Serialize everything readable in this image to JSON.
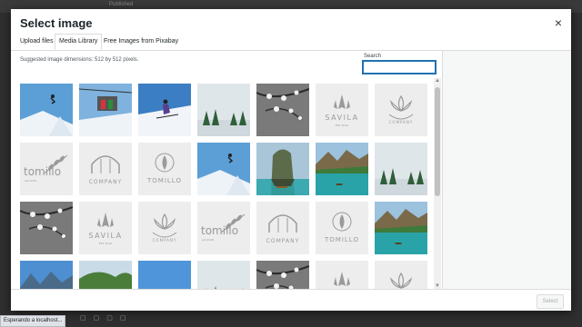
{
  "modal": {
    "title": "Select image",
    "close_glyph": "×",
    "tabs": [
      {
        "label": "Upload files",
        "active": false
      },
      {
        "label": "Media Library",
        "active": true
      },
      {
        "label": "Free Images from Pixabay",
        "active": false
      }
    ],
    "hint": "Suggested image dimensions: 512 by 512 pixels.",
    "search": {
      "label": "Search",
      "value": "",
      "placeholder": ""
    },
    "select_label": "Select"
  },
  "thumbnails": [
    {
      "kind": "snow-jump"
    },
    {
      "kind": "chairlift"
    },
    {
      "kind": "ski-blue"
    },
    {
      "kind": "pine-mist"
    },
    {
      "kind": "blossom"
    },
    {
      "kind": "savila-logo"
    },
    {
      "kind": "lotus-company"
    },
    {
      "kind": "tomillo-branch"
    },
    {
      "kind": "arch-company"
    },
    {
      "kind": "tomillo-leaf"
    },
    {
      "kind": "snow-jump"
    },
    {
      "kind": "lake-cliff"
    },
    {
      "kind": "lagoon"
    },
    {
      "kind": "pine-mist"
    },
    {
      "kind": "blossom"
    },
    {
      "kind": "savila-logo"
    },
    {
      "kind": "lotus-company"
    },
    {
      "kind": "tomillo-branch"
    },
    {
      "kind": "arch-company"
    },
    {
      "kind": "tomillo-leaf"
    },
    {
      "kind": "lagoon"
    },
    {
      "kind": "mountain-lake"
    },
    {
      "kind": "green-hills"
    },
    {
      "kind": "sky-blue"
    },
    {
      "kind": "pine-mist"
    },
    {
      "kind": "blossom"
    },
    {
      "kind": "savila-logo"
    },
    {
      "kind": "lotus-company"
    }
  ],
  "logo_text": {
    "savila": "SAVILA",
    "savila_sub": "EST 2019",
    "company": "COMPANY",
    "tomillo": "TOMILLO",
    "tomillo_script": "tomillo",
    "tomillo_sub": "est 2019"
  },
  "colors": {
    "accent": "#2271b1",
    "sky": "#5b9fd6",
    "snow": "#eef3f8",
    "teal": "#2aa3a8",
    "logo_gray": "#9a9a9a"
  },
  "statusbar": {
    "text": "Esperando a localhost..."
  },
  "background": {
    "label": "Published"
  }
}
